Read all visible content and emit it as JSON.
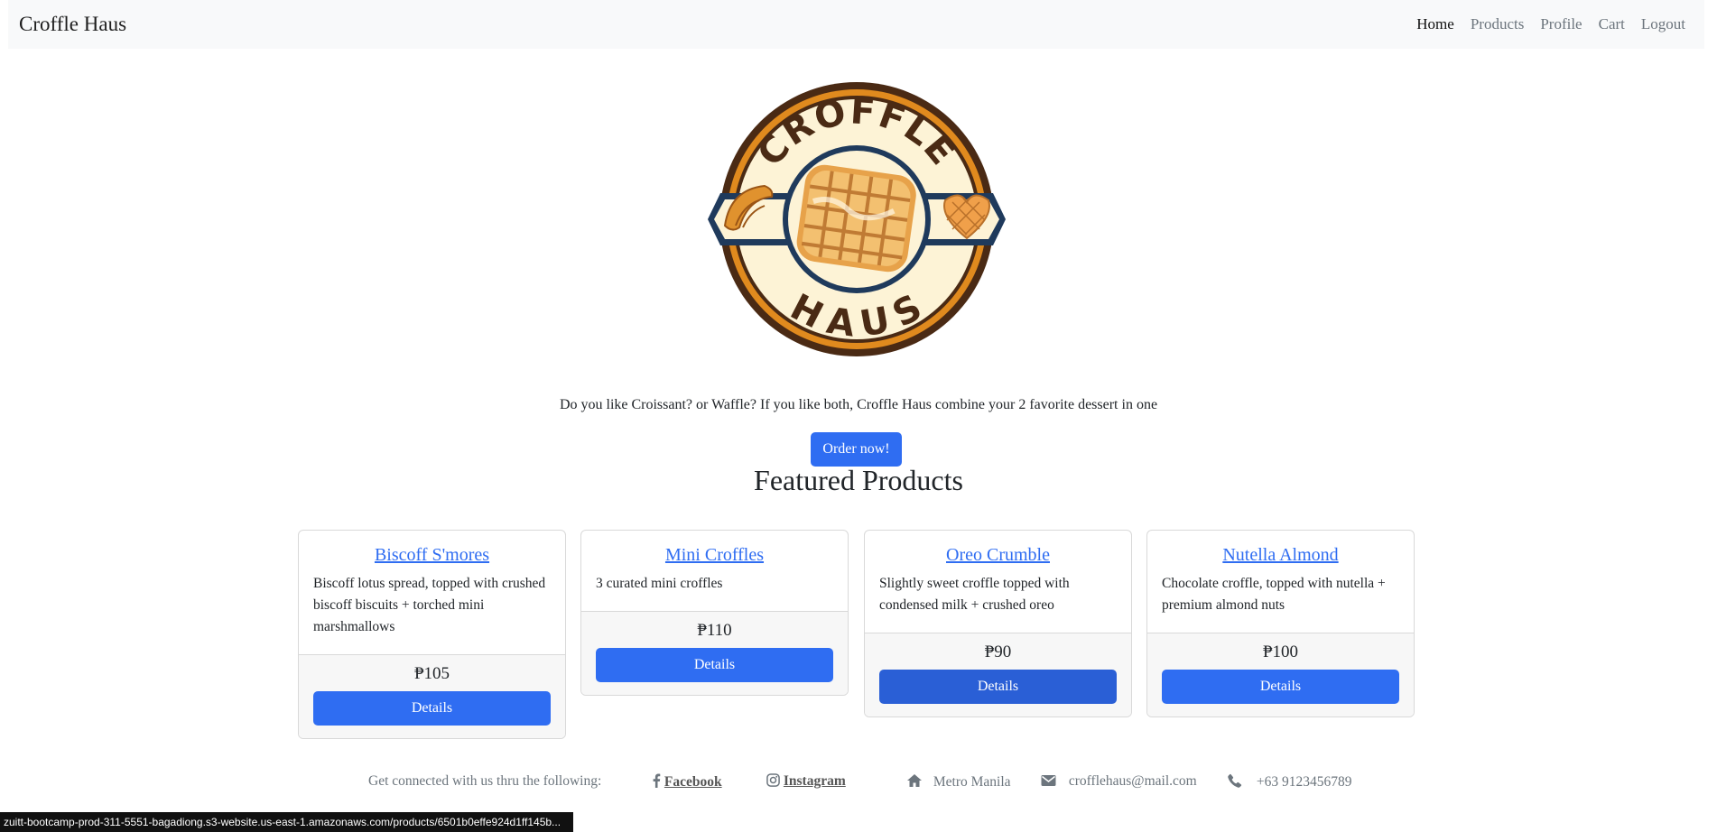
{
  "navbar": {
    "brand": "Croffle Haus",
    "links": [
      {
        "label": "Home",
        "active": true
      },
      {
        "label": "Products",
        "active": false
      },
      {
        "label": "Profile",
        "active": false
      },
      {
        "label": "Cart",
        "active": false
      },
      {
        "label": "Logout",
        "active": false
      }
    ]
  },
  "logo": {
    "top_text": "CROFFLE",
    "bottom_text": "HAUS"
  },
  "hero": {
    "text": "Do you like Croissant? or Waffle? If you like both, Croffle Haus combine your 2 favorite dessert in one",
    "button": "Order now!"
  },
  "featured": {
    "title": "Featured Products",
    "products": [
      {
        "name": "Biscoff S'mores",
        "description": "Biscoff lotus spread, topped with crushed biscoff biscuits + torched mini marshmallows",
        "price": "₱105",
        "button": "Details"
      },
      {
        "name": "Mini Croffles",
        "description": "3 curated mini croffles",
        "price": "₱110",
        "button": "Details"
      },
      {
        "name": "Oreo Crumble",
        "description": "Slightly sweet croffle topped with condensed milk + crushed oreo",
        "price": "₱90",
        "button": "Details"
      },
      {
        "name": "Nutella Almond",
        "description": "Chocolate croffle, topped with nutella + premium almond nuts",
        "price": "₱100",
        "button": "Details"
      }
    ]
  },
  "footer": {
    "connect_text": "Get connected with us thru the following:",
    "facebook": "Facebook",
    "instagram": "Instagram",
    "location": "Metro Manila",
    "email": "crofflehaus@mail.com",
    "phone": "+63 9123456789"
  },
  "status_bar": {
    "url": "zuitt-bootcamp-prod-311-5551-bagadiong.s3-website.us-east-1.amazonaws.com/products/6501b0effe924d1ff145b..."
  },
  "colors": {
    "primary": "#2f6df2",
    "navbar_bg": "#f8f9fa",
    "logo_brown": "#4a2a14",
    "logo_orange": "#e08a1e",
    "logo_navy": "#1f3a5c"
  }
}
